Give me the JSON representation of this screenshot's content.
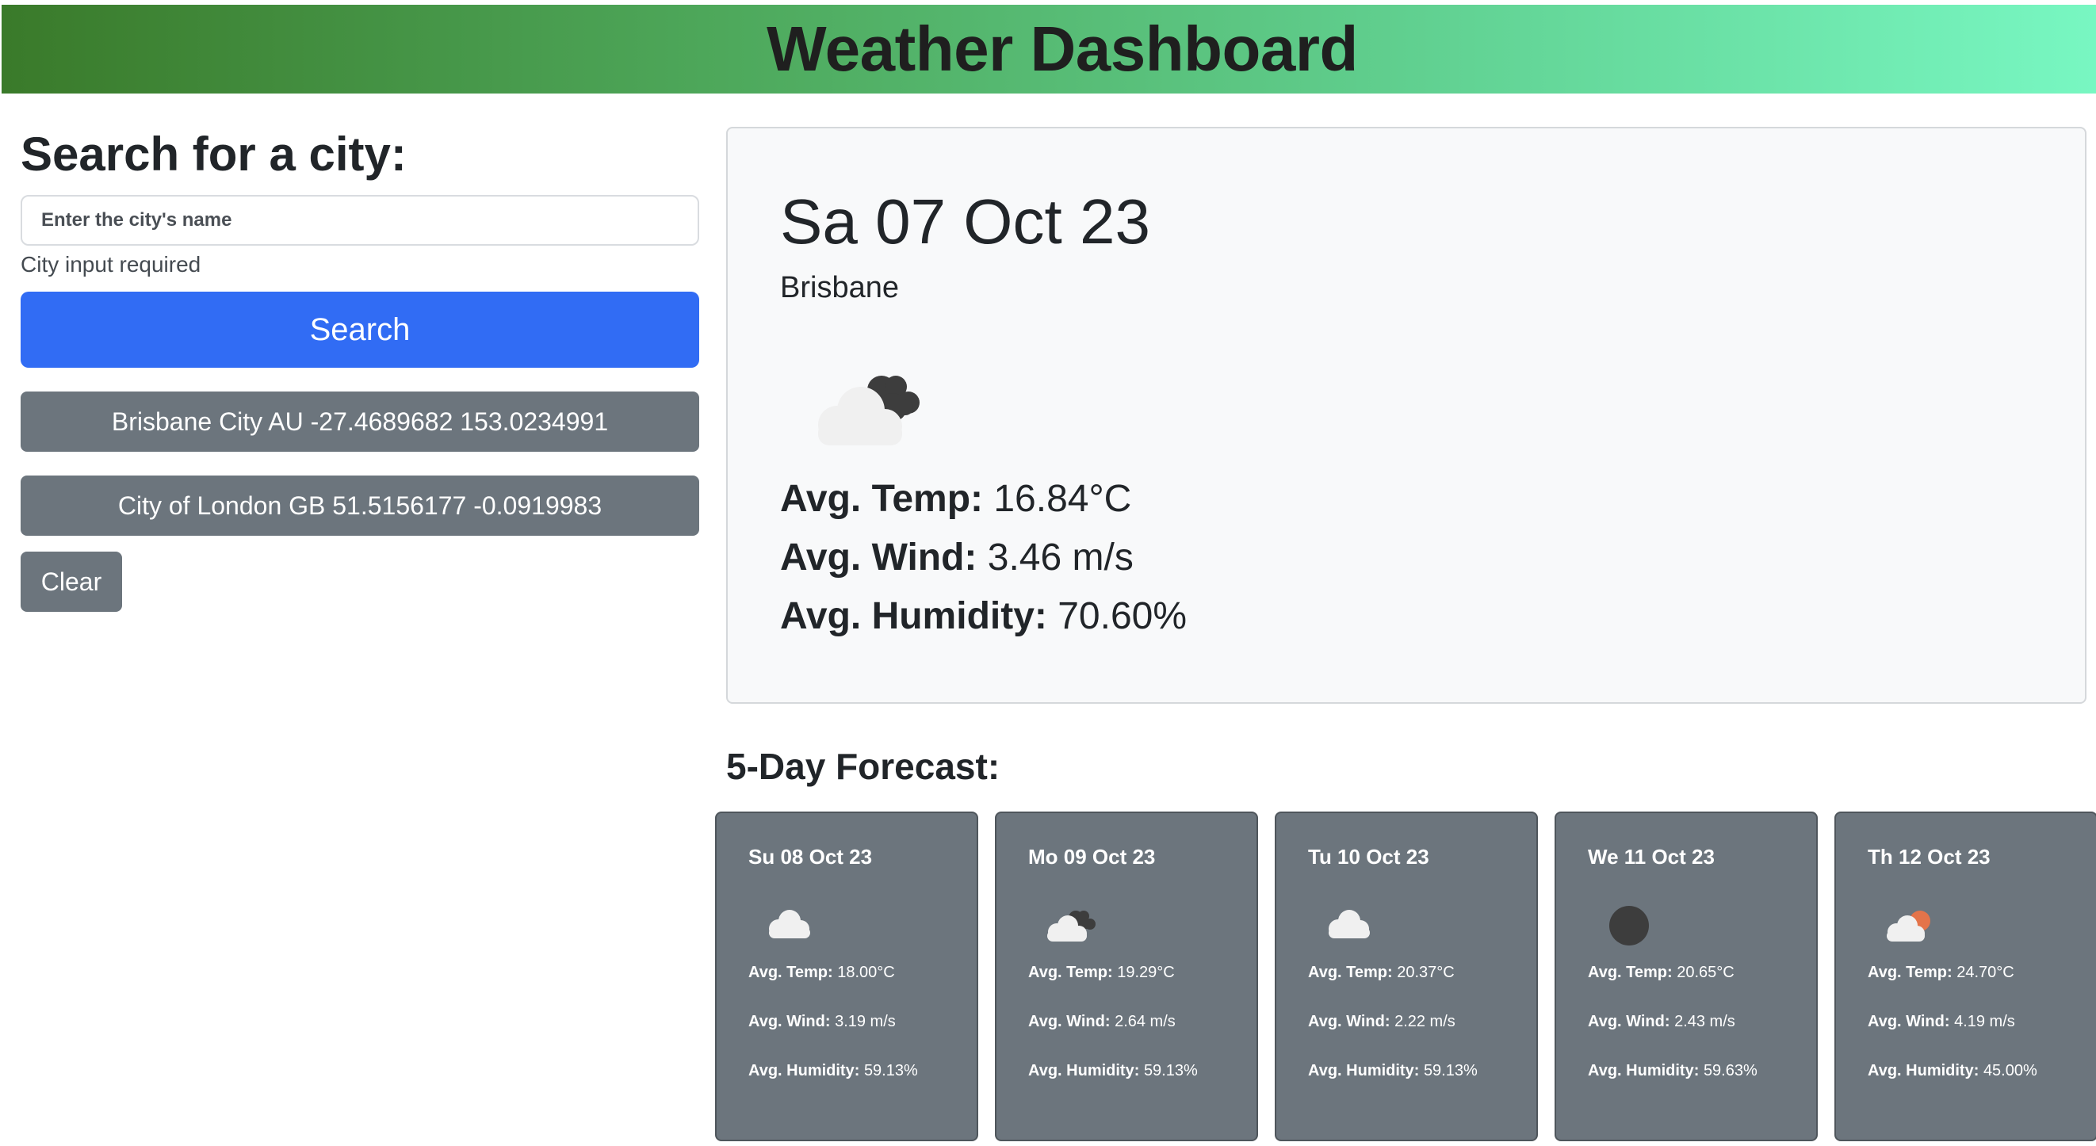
{
  "header": {
    "title": "Weather Dashboard"
  },
  "search": {
    "heading": "Search for a city:",
    "placeholder": "Enter the city's name",
    "hint": "City input required",
    "button_label": "Search"
  },
  "history": [
    {
      "label": "Brisbane City AU -27.4689682 153.0234991"
    },
    {
      "label": "City of London GB 51.5156177 -0.0919983"
    }
  ],
  "clear_label": "Clear",
  "current": {
    "date": "Sa 07 Oct 23",
    "city": "Brisbane",
    "icon": "broken-clouds-icon",
    "temp_label": "Avg. Temp:",
    "temp_value": "16.84°C",
    "wind_label": "Avg. Wind:",
    "wind_value": "3.46 m/s",
    "humidity_label": "Avg. Humidity:",
    "humidity_value": "70.60%"
  },
  "forecast": {
    "heading": "5-Day Forecast:",
    "days": [
      {
        "date": "Su 08 Oct 23",
        "icon": "cloud-icon",
        "temp_label": "Avg. Temp:",
        "temp": "18.00°C",
        "wind_label": "Avg. Wind:",
        "wind": "3.19 m/s",
        "humidity_label": "Avg. Humidity:",
        "humidity": "59.13%"
      },
      {
        "date": "Mo 09 Oct 23",
        "icon": "broken-clouds-icon",
        "temp_label": "Avg. Temp:",
        "temp": "19.29°C",
        "wind_label": "Avg. Wind:",
        "wind": "2.64 m/s",
        "humidity_label": "Avg. Humidity:",
        "humidity": "59.13%"
      },
      {
        "date": "Tu 10 Oct 23",
        "icon": "cloud-icon",
        "temp_label": "Avg. Temp:",
        "temp": "20.37°C",
        "wind_label": "Avg. Wind:",
        "wind": "2.22 m/s",
        "humidity_label": "Avg. Humidity:",
        "humidity": "59.13%"
      },
      {
        "date": "We 11 Oct 23",
        "icon": "dark-circle-icon",
        "temp_label": "Avg. Temp:",
        "temp": "20.65°C",
        "wind_label": "Avg. Wind:",
        "wind": "2.43 m/s",
        "humidity_label": "Avg. Humidity:",
        "humidity": "59.63%"
      },
      {
        "date": "Th 12 Oct 23",
        "icon": "partly-cloudy-icon",
        "temp_label": "Avg. Temp:",
        "temp": "24.70°C",
        "wind_label": "Avg. Wind:",
        "wind": "4.19 m/s",
        "humidity_label": "Avg. Humidity:",
        "humidity": "45.00%"
      }
    ]
  },
  "colors": {
    "header_gradient_start": "#3a7a2a",
    "header_gradient_end": "#78f7c2",
    "primary": "#316cf4",
    "secondary": "#6c757d",
    "card_bg": "#f8f9fa"
  }
}
